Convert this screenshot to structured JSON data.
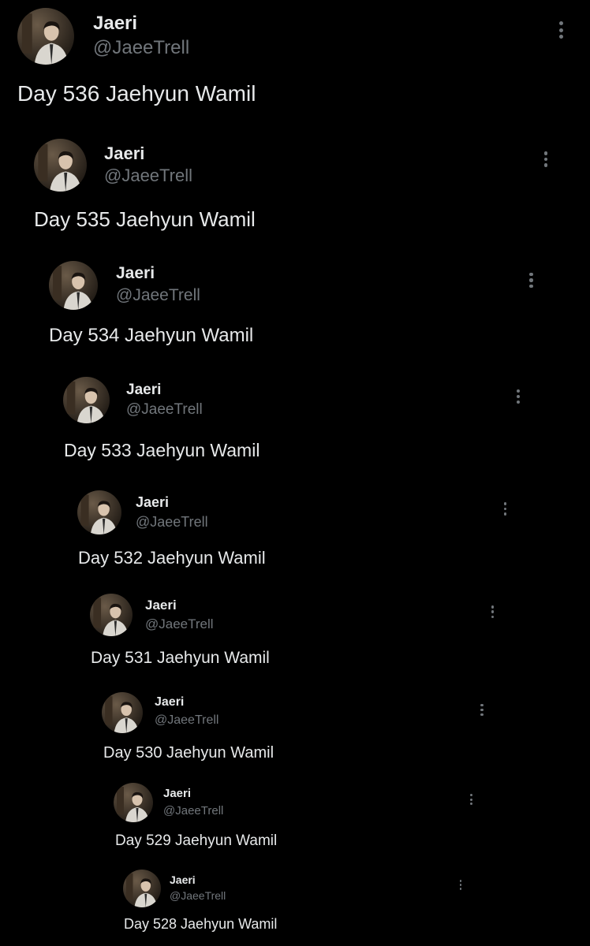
{
  "posts": [
    {
      "name": "Jaeri",
      "handle": "@JaeeTrell",
      "text": "Day 536 Jaehyun Wamil"
    },
    {
      "name": "Jaeri",
      "handle": "@JaeeTrell",
      "text": "Day 535 Jaehyun Wamil"
    },
    {
      "name": "Jaeri",
      "handle": "@JaeeTrell",
      "text": "Day 534 Jaehyun Wamil"
    },
    {
      "name": "Jaeri",
      "handle": "@JaeeTrell",
      "text": "Day 533 Jaehyun Wamil"
    },
    {
      "name": "Jaeri",
      "handle": "@JaeeTrell",
      "text": "Day 532 Jaehyun Wamil"
    },
    {
      "name": "Jaeri",
      "handle": "@JaeeTrell",
      "text": "Day 531 Jaehyun Wamil"
    },
    {
      "name": "Jaeri",
      "handle": "@JaeeTrell",
      "text": "Day 530 Jaehyun Wamil"
    },
    {
      "name": "Jaeri",
      "handle": "@JaeeTrell",
      "text": "Day 529 Jaehyun Wamil"
    },
    {
      "name": "Jaeri",
      "handle": "@JaeeTrell",
      "text": "Day 528 Jaehyun Wamil"
    }
  ],
  "icons": {
    "avatar": "profile-photo",
    "more": "more-vertical-icon"
  },
  "colors": {
    "background": "#000000",
    "primary_text": "#e7e9ea",
    "secondary_text": "#71767b"
  }
}
